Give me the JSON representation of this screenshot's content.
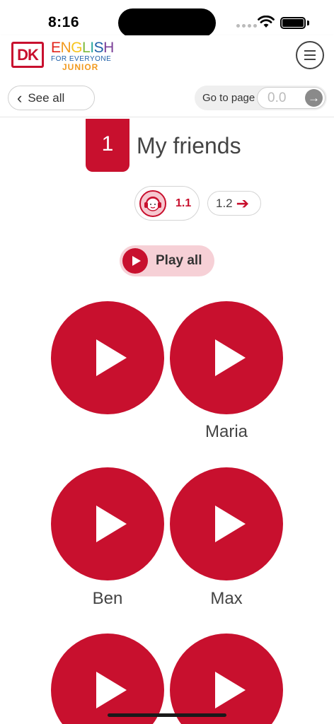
{
  "status": {
    "time": "8:16"
  },
  "header": {
    "logo": "DK",
    "brand_line1": [
      "E",
      "N",
      "G",
      "L",
      "I",
      "S",
      "H"
    ],
    "brand_line1_colors": [
      "#e2231a",
      "#f29a1f",
      "#f7c51e",
      "#7bb93b",
      "#2aa6a0",
      "#1d5fa8",
      "#7b3f98"
    ],
    "brand_line2": "FOR EVERYONE",
    "brand_line3": "JUNIOR",
    "menu_icon": "hamburger-icon"
  },
  "nav": {
    "back_label": "See all",
    "goto_label": "Go to page",
    "goto_placeholder": "0.0"
  },
  "unit": {
    "number": "1",
    "title": "My friends"
  },
  "lessons": {
    "current": "1.1",
    "next": "1.2"
  },
  "play_all_label": "Play all",
  "audio_items": [
    {
      "label": ""
    },
    {
      "label": "Maria"
    },
    {
      "label": "Ben"
    },
    {
      "label": "Max"
    },
    {
      "label": ""
    },
    {
      "label": ""
    }
  ],
  "colors": {
    "accent": "#c8102e",
    "accent_light": "#f6d0d6"
  }
}
